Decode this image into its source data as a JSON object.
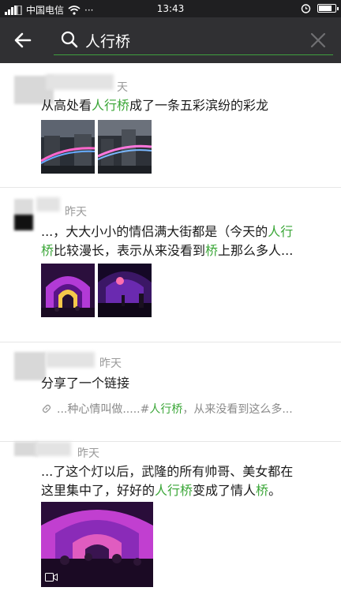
{
  "status_bar": {
    "carrier": "中国电信",
    "time": "13:43",
    "battery_percent": 85,
    "icons": [
      "signal-icon",
      "wifi-icon",
      "more-icon",
      "alarm-icon",
      "battery-icon"
    ]
  },
  "search": {
    "query": "人行桥",
    "accent_color": "#3fa03f"
  },
  "results": [
    {
      "date": "天",
      "text_before": "从高处看",
      "highlight": "人行桥",
      "text_after": "成了一条五彩滨纷的彩龙"
    },
    {
      "date": "昨天",
      "line1_before": "...，大大小小的情侣满大街都是（今天的",
      "line1_highlight": "人行",
      "line2_highlight1": "桥",
      "line2_mid": "比较漫长，表示从来没看到",
      "line2_highlight2": "桥",
      "line2_after": "上那么多人..."
    },
    {
      "date": "昨天",
      "text": "分享了一个链接",
      "link_before": "...种心情叫做.....#",
      "link_highlight": "人行桥",
      "link_after": "，从来没看到这么多..."
    },
    {
      "date": "昨天",
      "line1": "...了这个灯以后，武隆的所有帅哥、美女都在",
      "line2_before": "这里集中了，好好的",
      "line2_highlight1": "人行桥",
      "line2_mid": "变成了情人",
      "line2_highlight2": "桥",
      "line2_after": "。"
    }
  ]
}
